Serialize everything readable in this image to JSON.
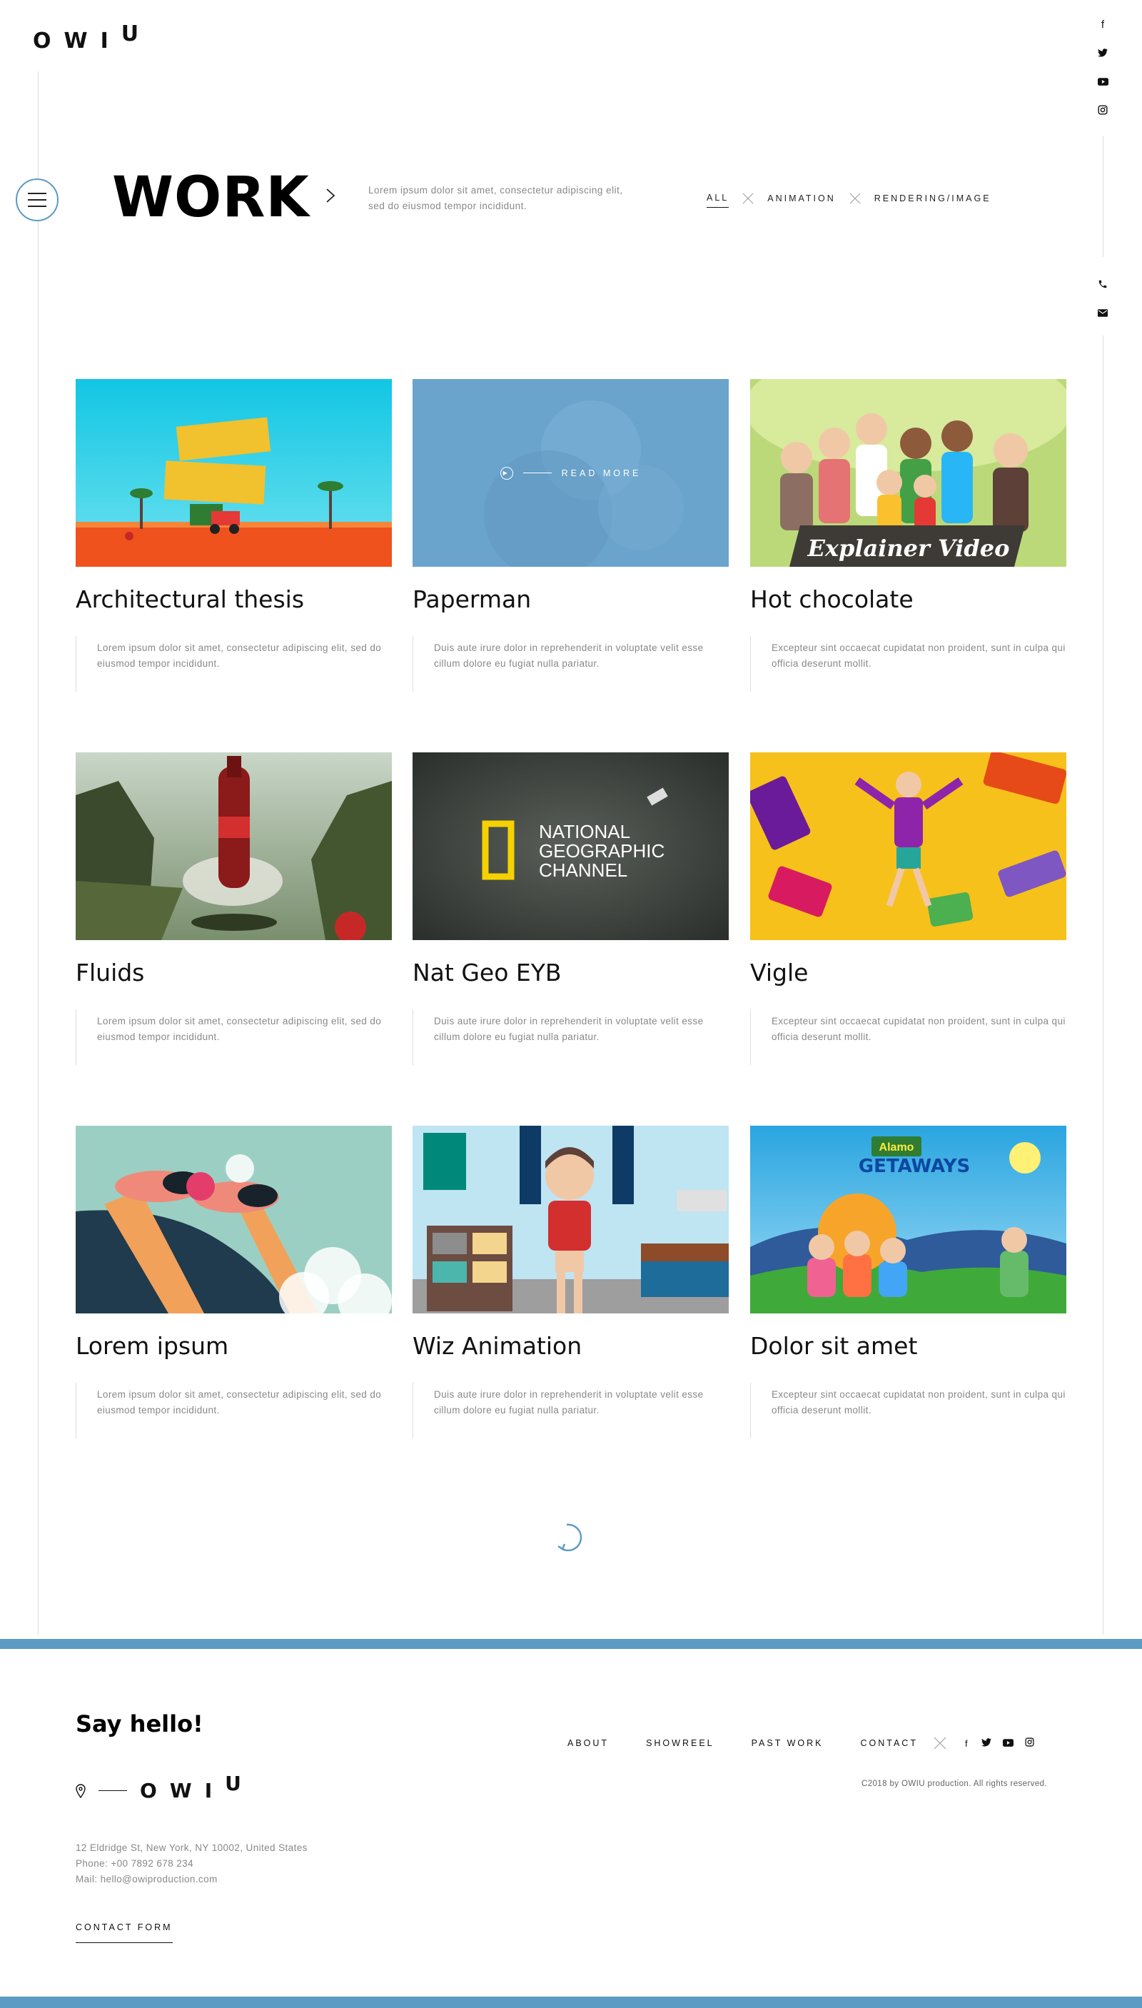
{
  "brand": {
    "logo_main": "OWI",
    "logo_u": "U"
  },
  "social": [
    "f",
    "t",
    "▶",
    "◎"
  ],
  "contact_icons": [
    "✆",
    "✉"
  ],
  "hero": {
    "title": "WORK",
    "description": "Lorem ipsum dolor sit amet, consectetur adipiscing elit, sed do eiusmod tempor incididunt."
  },
  "filters": [
    "ALL",
    "ANIMATION",
    "RENDERING/IMAGE"
  ],
  "projects": [
    {
      "title": "Architectural thesis",
      "desc": "Lorem ipsum dolor sit amet, consectetur adipiscing elit, sed do eiusmod tempor incididunt."
    },
    {
      "title": "Paperman",
      "desc": "Duis aute irure dolor in reprehenderit in voluptate velit esse cillum dolore eu fugiat nulla pariatur.",
      "overlay": "READ MORE"
    },
    {
      "title": "Hot chocolate",
      "desc": "Excepteur sint occaecat cupidatat non proident, sunt in culpa qui officia deserunt mollit.",
      "overlay_text": "Explainer Video"
    },
    {
      "title": "Fluids",
      "desc": "Lorem ipsum dolor sit amet, consectetur adipiscing elit, sed do eiusmod tempor incididunt."
    },
    {
      "title": "Nat Geo EYB",
      "desc": "Duis aute irure dolor in reprehenderit in voluptate velit esse cillum dolore eu fugiat nulla pariatur.",
      "overlay_text": "NATIONAL\nGEOGRAPHIC\nCHANNEL"
    },
    {
      "title": "Vigle",
      "desc": "Excepteur sint occaecat cupidatat non proident, sunt in culpa qui officia deserunt mollit."
    },
    {
      "title": "Lorem ipsum",
      "desc": "Lorem ipsum dolor sit amet, consectetur adipiscing elit, sed do eiusmod tempor incididunt."
    },
    {
      "title": "Wiz Animation",
      "desc": "Duis aute irure dolor in reprehenderit in voluptate velit esse cillum dolore eu fugiat nulla pariatur."
    },
    {
      "title": "Dolor sit amet",
      "desc": "Excepteur sint occaecat cupidatat non proident, sunt in culpa qui officia deserunt mollit.",
      "overlay_text": "GETAWAYS"
    }
  ],
  "footer": {
    "say_hello": "Say hello!",
    "address": "12 Eldridge St, New York, NY 10002, United States",
    "phone": "Phone: +00 7892 678 234",
    "mail": "Mail: hello@owiproduction.com",
    "contact_form": "CONTACT FORM",
    "nav": [
      "ABOUT",
      "SHOWREEL",
      "PAST WORK",
      "CONTACT"
    ],
    "copyright": "C2018 by OWIU production. All rights reserved."
  },
  "colors": {
    "accent": "#5b9bc4"
  }
}
